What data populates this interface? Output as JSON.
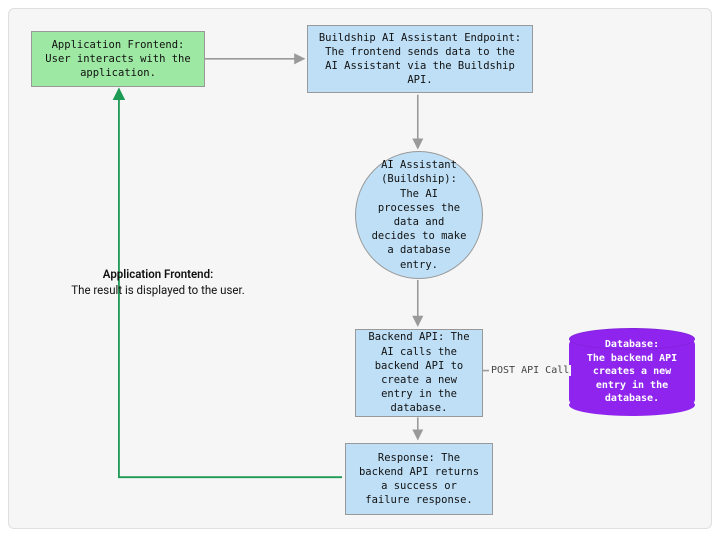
{
  "diagram": {
    "type": "flowchart",
    "nodes": {
      "frontend": {
        "title": "Application Frontend:",
        "body": "User interacts with the application."
      },
      "endpoint": {
        "title": "Buildship AI Assistant Endpoint:",
        "body": "The frontend sends data to the AI Assistant via the Buildship API."
      },
      "assistant": {
        "title": "AI Assistant (Buildship):",
        "body": "The AI processes the data and decides to make a database entry."
      },
      "backend": {
        "title": "Backend API:",
        "body": "The AI calls the backend API to create a new entry in the database."
      },
      "database": {
        "title": "Database:",
        "body": "The backend API creates a new entry in the database."
      },
      "response": {
        "title": "Response:",
        "body": "The backend API returns a success or failure response."
      }
    },
    "edges": {
      "post_api_call": "POST API Call"
    },
    "labels": {
      "display_result_line1": "Application Frontend:",
      "display_result_line2": "The result is displayed to the user."
    }
  },
  "colors": {
    "green": "#9de8a2",
    "blue": "#bedff6",
    "purple": "#8e24ed",
    "edge_gray": "#9a9a9a",
    "edge_green": "#1d9a54"
  }
}
